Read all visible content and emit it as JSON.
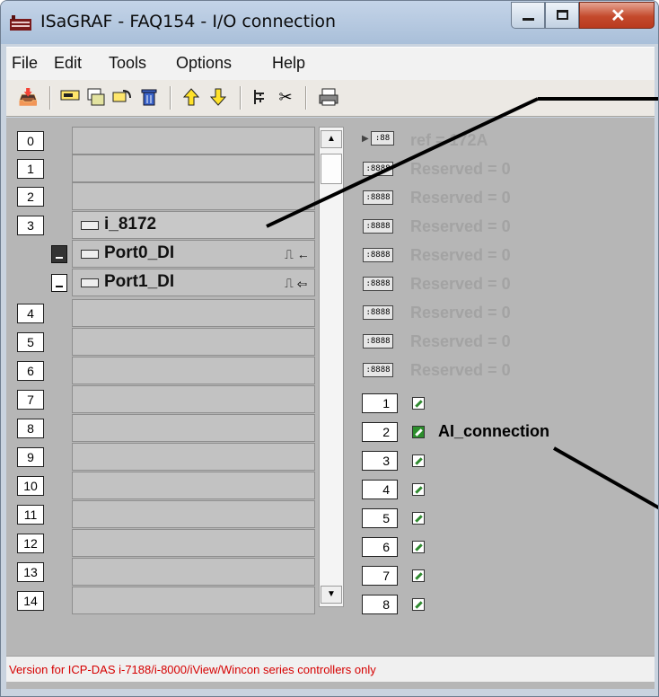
{
  "window": {
    "title": "ISaGRAF - FAQ154 - I/O connection"
  },
  "menu": [
    "File",
    "Edit",
    "Tools",
    "Options",
    "Help"
  ],
  "toolbar_icons": [
    "open-icon",
    "connect-icon",
    "copy-board-icon",
    "refresh-icon",
    "delete-icon",
    "up-arrow-icon",
    "down-arrow-icon",
    "tree-icon",
    "cut-icon",
    "print-icon"
  ],
  "slots": [
    {
      "num": "0"
    },
    {
      "num": "1"
    },
    {
      "num": "2"
    },
    {
      "num": "3",
      "label": "i_8172"
    },
    {
      "num": "4"
    },
    {
      "num": "5"
    },
    {
      "num": "6"
    },
    {
      "num": "7"
    },
    {
      "num": "8"
    },
    {
      "num": "9"
    },
    {
      "num": "10"
    },
    {
      "num": "11"
    },
    {
      "num": "12"
    },
    {
      "num": "13"
    },
    {
      "num": "14"
    }
  ],
  "sub_boards": [
    {
      "label": "Port0_DI",
      "dir": "⎍ ←"
    },
    {
      "label": "Port1_DI",
      "dir": "⎍ ⇦"
    }
  ],
  "channels": {
    "ref": "ref = 172A",
    "reserved": [
      "Reserved = 0",
      "Reserved = 0",
      "Reserved = 0",
      "Reserved = 0",
      "Reserved = 0",
      "Reserved = 0",
      "Reserved = 0",
      "Reserved = 0"
    ],
    "io": [
      "1",
      "2",
      "3",
      "4",
      "5",
      "6",
      "7",
      "8"
    ],
    "connected_label": "AI_connection"
  },
  "status": "Version for ICP-DAS i-7188/i-8000/iView/Wincon series controllers only",
  "colors": {
    "status_text": "#d60000",
    "client_bg": "#b6b6b6"
  }
}
